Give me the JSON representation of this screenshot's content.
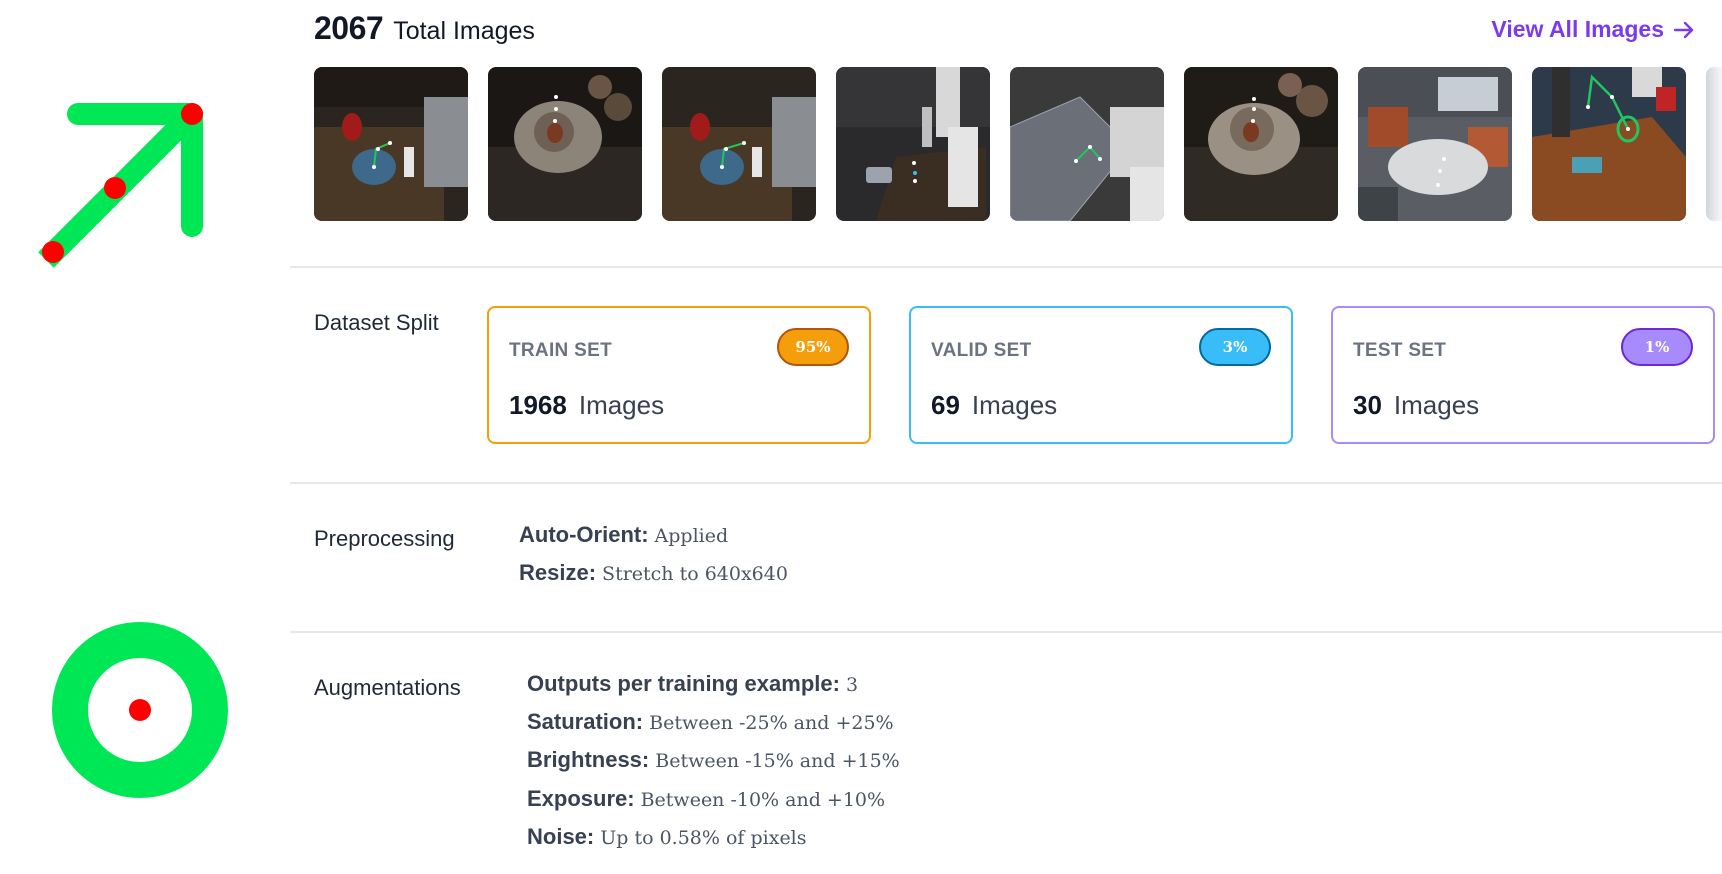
{
  "overlay": {
    "arrow_icon": "up-right-arrow-icon",
    "target_icon": "target-ring-icon",
    "colors": {
      "green": "#00e756",
      "red": "#ff0000"
    }
  },
  "header": {
    "total_count": "2067",
    "total_label": "Total Images",
    "view_all_label": "View All Images",
    "view_all_icon": "arrow-right-icon"
  },
  "thumbnails": [
    {
      "name": "thumbnail-1",
      "scene": "kitchen-counter-bowl"
    },
    {
      "name": "thumbnail-2",
      "scene": "dark-table-pot"
    },
    {
      "name": "thumbnail-3",
      "scene": "kitchen-counter-bowl"
    },
    {
      "name": "thumbnail-4",
      "scene": "robot-arm-dark-room"
    },
    {
      "name": "thumbnail-5",
      "scene": "robot-checkered-cloth"
    },
    {
      "name": "thumbnail-6",
      "scene": "dark-table-pot"
    },
    {
      "name": "thumbnail-7",
      "scene": "office-round-table"
    },
    {
      "name": "thumbnail-8",
      "scene": "robot-wooden-table"
    }
  ],
  "dataset_split": {
    "title": "Dataset Split",
    "sets": [
      {
        "name": "TRAIN SET",
        "percent": "95%",
        "count": "1968",
        "unit": "Images",
        "border": "#f59e0b",
        "badge_bg": "#f59e0b",
        "badge_border": "#b45309"
      },
      {
        "name": "VALID SET",
        "percent": "3%",
        "count": "69",
        "unit": "Images",
        "border": "#38bdf8",
        "badge_bg": "#38bdf8",
        "badge_border": "#0369a1"
      },
      {
        "name": "TEST SET",
        "percent": "1%",
        "count": "30",
        "unit": "Images",
        "border": "#a78bfa",
        "badge_bg": "#a78bfa",
        "badge_border": "#6d28d9"
      }
    ]
  },
  "preprocessing": {
    "title": "Preprocessing",
    "items": [
      {
        "key": "Auto-Orient:",
        "value": "Applied"
      },
      {
        "key": "Resize:",
        "value": "Stretch to 640x640"
      }
    ]
  },
  "augmentations": {
    "title": "Augmentations",
    "items": [
      {
        "key": "Outputs per training example:",
        "value": "3"
      },
      {
        "key": "Saturation:",
        "value": "Between -25% and +25%"
      },
      {
        "key": "Brightness:",
        "value": "Between -15% and +15%"
      },
      {
        "key": "Exposure:",
        "value": "Between -10% and +10%"
      },
      {
        "key": "Noise:",
        "value": "Up to 0.58% of pixels"
      }
    ]
  },
  "colors": {
    "accent": "#7c3aed",
    "divider": "#e5e7eb"
  }
}
